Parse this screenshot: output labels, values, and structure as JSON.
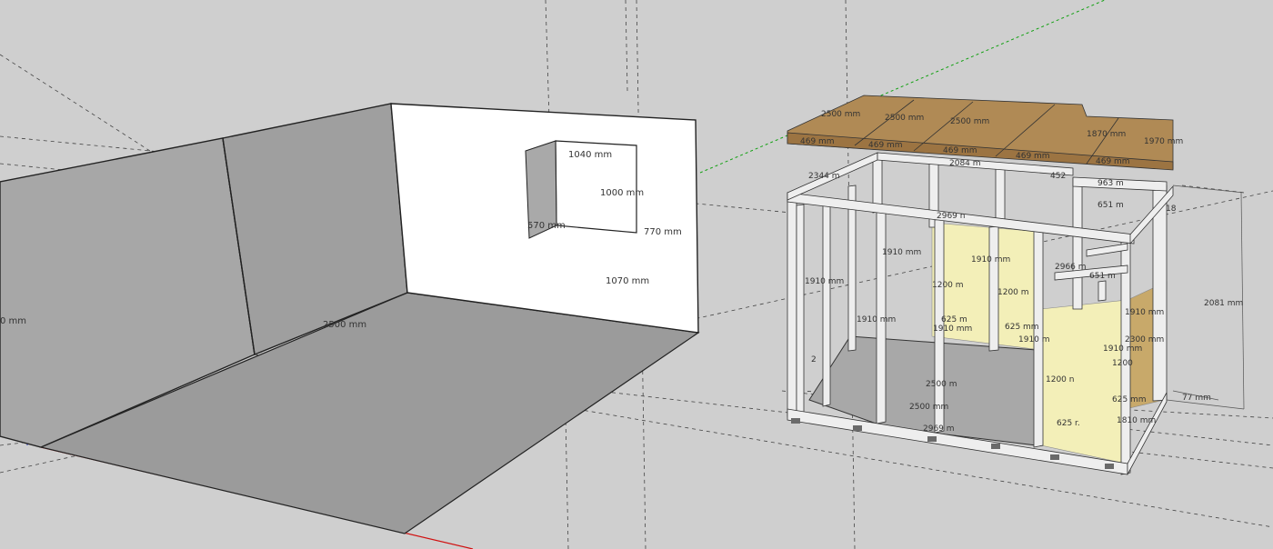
{
  "viewport_label": "",
  "axes": {
    "red": "#d01010",
    "green": "#11a011",
    "blue": "#2030c0"
  },
  "colors": {
    "background": "#cfcfcf",
    "wall_gray": "#a3a3a3",
    "wall_white": "#ffffff",
    "floor": "#9b9b9b",
    "frame": "#eeeeee",
    "osb_board": "#f3efb8",
    "roof_wood": "#b08a55"
  },
  "left_room": {
    "dims": {
      "window_width": "1040 mm",
      "window_height": "1000 mm",
      "window_reveal": "570 mm",
      "window_offset": "770 mm",
      "sill_height": "1070 mm",
      "floor_length": "2500 mm",
      "left_edge": "0 mm"
    }
  },
  "shed": {
    "roof_dims": [
      "2500 mm",
      "2500 mm",
      "2500 mm",
      "1870 mm",
      "1970 mm",
      "469 mm",
      "469 mm",
      "469 mm",
      "469 mm",
      "469 mm"
    ],
    "frame_dims": [
      "2084 m",
      "2344 m",
      "452",
      "963 m",
      "651 m",
      "18",
      "2969 n",
      "1910 mm",
      "1910 mm",
      "1910 mm",
      "1910 mm",
      "1910 mm",
      "1200 m",
      "1200 m",
      "1200 n",
      "625 m",
      "625 mm",
      "625 r.",
      "1910 m",
      "2081 mm",
      "2500 m",
      "2500 mm",
      "2969 m",
      "625 mm",
      "77 mm",
      "1910 mm",
      "1200",
      "1910 mm",
      "1810 mm",
      "2300 mm",
      "2966 m",
      "651 m",
      "2"
    ]
  }
}
